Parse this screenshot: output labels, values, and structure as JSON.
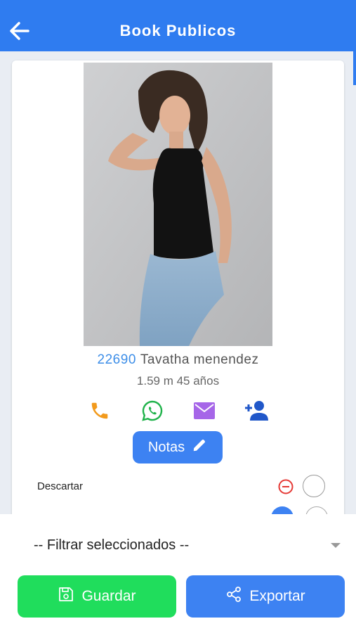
{
  "header": {
    "title": "Book Publicos"
  },
  "profile": {
    "code": "22690",
    "name": "Tavatha menendez",
    "stats": "1.59 m 45 años"
  },
  "actions": {
    "icons": [
      "phone-icon",
      "whatsapp-icon",
      "mail-icon",
      "add-user-icon"
    ],
    "colors": {
      "phone": "#f29a1c",
      "whatsapp": "#1fb24a",
      "mail": "#a666e8",
      "add_user": "#2057c9"
    }
  },
  "notes_button": {
    "label": "Notas"
  },
  "options": {
    "discard_label": "Descartar"
  },
  "bottom": {
    "filter_value": "-- Filtrar seleccionados --",
    "save_label": "Guardar",
    "export_label": "Exportar"
  },
  "colors": {
    "accent": "#2f7cf0",
    "save": "#20dd5c",
    "export": "#3d82f2",
    "danger": "#e53935"
  }
}
